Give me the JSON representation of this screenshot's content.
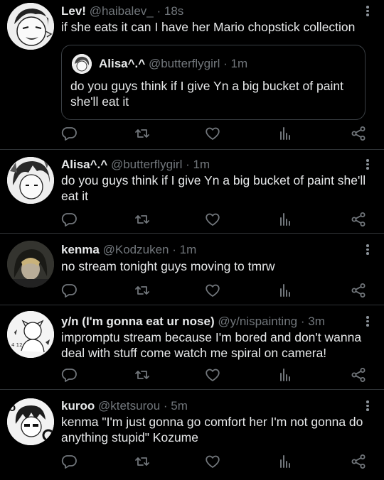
{
  "tweets": [
    {
      "name": "Lev!",
      "handle": "@haibalev_",
      "time": "18s",
      "text": "if she eats it can I have her Mario chopstick collection",
      "quote": {
        "name": "Alisa^.^",
        "handle": "@butterflygirl",
        "time": "1m",
        "text": "do you guys think if I give Yn a big bucket of paint she'll eat it"
      }
    },
    {
      "name": "Alisa^.^",
      "handle": "@butterflygirl",
      "time": "1m",
      "text": "do you guys think if I give Yn a big bucket of paint she'll eat it"
    },
    {
      "name": "kenma",
      "handle": "@Kodzuken",
      "time": "1m",
      "text": "no stream tonight guys moving to tmrw"
    },
    {
      "name": "y/n (I'm gonna eat ur nose)",
      "handle": "@y/nispainting",
      "time": "3m",
      "text": "impromptu stream because I'm bored and don't wanna deal with stuff come watch me spiral on camera!"
    },
    {
      "name": "kuroo",
      "handle": "@ktetsurou",
      "time": "5m",
      "text": "kenma \"I'm just gonna go comfort her I'm not gonna do anything stupid\" Kozume"
    }
  ],
  "separator": "·",
  "icons": [
    "reply-icon",
    "retweet-icon",
    "like-icon",
    "views-icon",
    "share-icon",
    "more-icon"
  ],
  "colors": {
    "background": "#000000",
    "text": "#e7e9ea",
    "muted": "#71767b",
    "divider": "#2f3336"
  }
}
